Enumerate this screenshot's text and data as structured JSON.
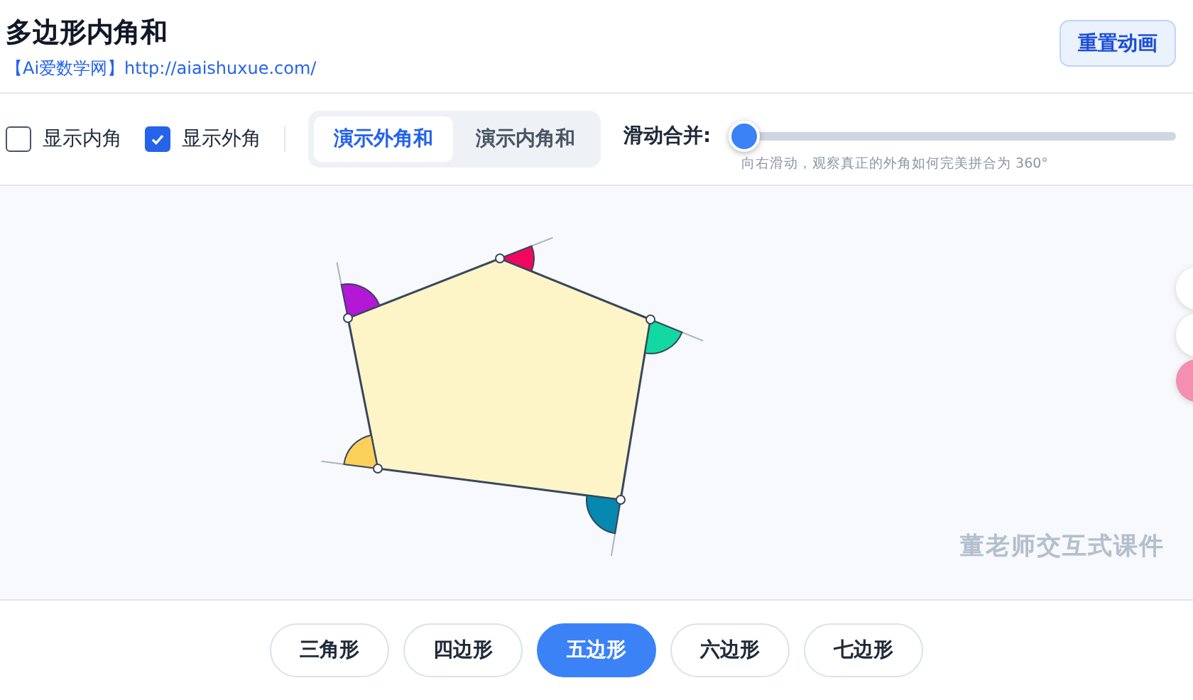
{
  "header": {
    "title": "多边形内角和",
    "site_link": "【Ai爱数学网】http://aiaishuxue.com/",
    "reset_button": "重置动画"
  },
  "toolbar": {
    "checkboxes": [
      {
        "label": "显示内角",
        "checked": false
      },
      {
        "label": "显示外角",
        "checked": true
      }
    ],
    "modes": [
      {
        "label": "演示外角和",
        "selected": true
      },
      {
        "label": "演示内角和",
        "selected": false
      }
    ],
    "slider": {
      "label": "滑动合并:",
      "level": 0,
      "hint": "向右滑动，观察真正的外角如何完美拼合为 360°"
    }
  },
  "canvas": {
    "exterior_angles": [
      {
        "color": "#b517d6"
      },
      {
        "color": "#f2075f"
      },
      {
        "color": "#12d9a2"
      },
      {
        "color": "#0688b0"
      },
      {
        "color": "#fdd05c"
      }
    ],
    "brand_mark": "董老师交互式课件"
  },
  "shape_tabs": [
    {
      "label": "三角形",
      "selected": false
    },
    {
      "label": "四边形",
      "selected": false
    },
    {
      "label": "五边形",
      "selected": true
    },
    {
      "label": "六边形",
      "selected": false
    },
    {
      "label": "七边形",
      "selected": false
    }
  ]
}
